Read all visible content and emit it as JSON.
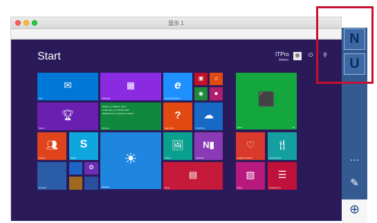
{
  "window": {
    "title": "显示 1"
  },
  "startscreen": {
    "heading": "Start",
    "user": {
      "name": "ITPro",
      "role": "Admin"
    },
    "icons": {
      "power": "power-icon",
      "search": "search-icon"
    }
  },
  "tiles": [
    {
      "id": "mail",
      "label": "Mail",
      "color": "#0078d7",
      "icon": "mail-icon"
    },
    {
      "id": "calendar",
      "label": "Calendar",
      "color": "#8a2be2",
      "icon": "calendar-icon"
    },
    {
      "id": "ie",
      "label": "Internet Explorer",
      "color": "#1e90ff",
      "icon": "internet-explorer-icon"
    },
    {
      "id": "video",
      "label": "",
      "color": "#c0112b",
      "icon": "video-icon"
    },
    {
      "id": "music",
      "label": "",
      "color": "#e04a0f",
      "icon": "music-icon"
    },
    {
      "id": "games",
      "label": "",
      "color": "#1e8a3a",
      "icon": "games-icon"
    },
    {
      "id": "camera",
      "label": "",
      "color": "#b01f6d",
      "icon": "camera-icon"
    },
    {
      "id": "store",
      "label": "Store",
      "color": "#14a73d",
      "icon": "store-icon"
    },
    {
      "id": "store-badge",
      "label": "16"
    },
    {
      "id": "sports",
      "label": "Sports",
      "color": "#6a1fb0",
      "icon": "trophy-icon"
    },
    {
      "id": "finance",
      "label": "Finance",
      "color": "#10893e",
      "icon": "finance-icon"
    },
    {
      "id": "help",
      "label": "Help+Tips",
      "color": "#e24a12",
      "icon": "help-icon"
    },
    {
      "id": "onedrive",
      "label": "OneDrive",
      "color": "#1769c6",
      "icon": "cloud-icon"
    },
    {
      "id": "people",
      "label": "People",
      "color": "#e0441d",
      "icon": "people-icon"
    },
    {
      "id": "skype",
      "label": "Skype",
      "color": "#0fa6e0",
      "icon": "skype-icon"
    },
    {
      "id": "weather",
      "label": "Weather",
      "color": "#1f86e0",
      "icon": "sun-icon"
    },
    {
      "id": "photos",
      "label": "Photos",
      "color": "#0aa08f",
      "icon": "photo-icon"
    },
    {
      "id": "onenote",
      "label": "OneNote",
      "color": "#8a3ab5",
      "icon": "onenote-icon"
    },
    {
      "id": "health",
      "label": "Health & Fitness",
      "color": "#d93a2b",
      "icon": "heart-icon"
    },
    {
      "id": "food",
      "label": "Food & Drink",
      "color": "#14a0a0",
      "icon": "food-icon"
    },
    {
      "id": "desktop",
      "label": "Desktop",
      "color": "#2a5ca8",
      "icon": "desktop-icon"
    },
    {
      "id": "news",
      "label": "News",
      "color": "#c51a3a",
      "icon": "news-icon"
    },
    {
      "id": "maps",
      "label": "Maps",
      "color": "#b8197d",
      "icon": "map-icon"
    },
    {
      "id": "readinglist",
      "label": "Reading List",
      "color": "#c0113b",
      "icon": "reading-list-icon"
    }
  ],
  "finance": {
    "lines": [
      "DOW ▲ 17,068.26 +40.9",
      "FTSE 100 ▲ 6,750.28 +8.85",
      "NIKKEI 225 ▼ 16,060.72 -156.09"
    ]
  },
  "sidepanel": {
    "btn_n": "N",
    "btn_u": "U",
    "more": "···",
    "pen": "✎",
    "zoom": "⊕"
  },
  "colors": {
    "start_bg": "#2b1a5a",
    "panel_bg": "#345b91",
    "highlight": "#c8102e"
  }
}
